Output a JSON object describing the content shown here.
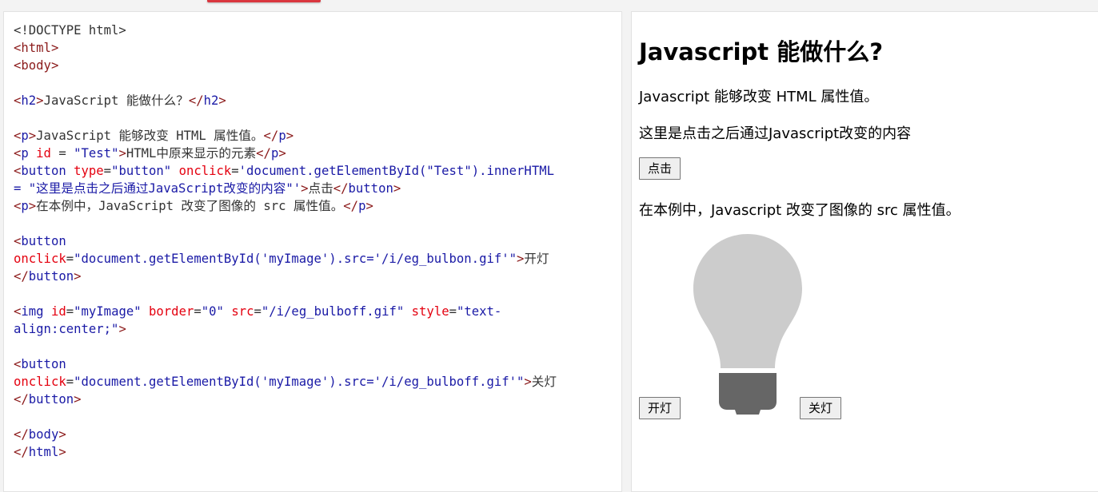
{
  "code_lines": [
    [
      {
        "t": "<!DOCTYPE html>",
        "c": "txt"
      }
    ],
    [
      {
        "t": "<",
        "c": "tag"
      },
      {
        "t": "html",
        "c": "tag"
      },
      {
        "t": ">",
        "c": "tag"
      }
    ],
    [
      {
        "t": "<",
        "c": "tag"
      },
      {
        "t": "body",
        "c": "tag"
      },
      {
        "t": ">",
        "c": "tag"
      }
    ],
    [],
    [
      {
        "t": "<",
        "c": "tag"
      },
      {
        "t": "h2",
        "c": "tn"
      },
      {
        "t": ">",
        "c": "tag"
      },
      {
        "t": "JavaScript 能做什么？",
        "c": "txt"
      },
      {
        "t": "</",
        "c": "tag"
      },
      {
        "t": "h2",
        "c": "tn"
      },
      {
        "t": ">",
        "c": "tag"
      }
    ],
    [],
    [
      {
        "t": "<",
        "c": "tag"
      },
      {
        "t": "p",
        "c": "tn"
      },
      {
        "t": ">",
        "c": "tag"
      },
      {
        "t": "JavaScript 能够改变 HTML 属性值。",
        "c": "txt"
      },
      {
        "t": "</",
        "c": "tag"
      },
      {
        "t": "p",
        "c": "tn"
      },
      {
        "t": ">",
        "c": "tag"
      }
    ],
    [
      {
        "t": "<",
        "c": "tag"
      },
      {
        "t": "p ",
        "c": "tn"
      },
      {
        "t": "id",
        "c": "attr"
      },
      {
        "t": " = ",
        "c": "txt"
      },
      {
        "t": "\"Test\"",
        "c": "val"
      },
      {
        "t": ">",
        "c": "tag"
      },
      {
        "t": "HTML中原来显示的元素",
        "c": "txt"
      },
      {
        "t": "</",
        "c": "tag"
      },
      {
        "t": "p",
        "c": "tn"
      },
      {
        "t": ">",
        "c": "tag"
      }
    ],
    [
      {
        "t": "<",
        "c": "tag"
      },
      {
        "t": "button ",
        "c": "tn"
      },
      {
        "t": "type",
        "c": "attr"
      },
      {
        "t": "=",
        "c": "txt"
      },
      {
        "t": "\"button\" ",
        "c": "val"
      },
      {
        "t": "onclick",
        "c": "attr"
      },
      {
        "t": "=",
        "c": "txt"
      },
      {
        "t": "'document.getElementById(\"Test\").innerHTML",
        "c": "val"
      }
    ],
    [
      {
        "t": "= \"这里是点击之后通过JavaScript改变的内容\"'",
        "c": "val"
      },
      {
        "t": ">",
        "c": "tag"
      },
      {
        "t": "点击",
        "c": "txt"
      },
      {
        "t": "</",
        "c": "tag"
      },
      {
        "t": "button",
        "c": "tn"
      },
      {
        "t": ">",
        "c": "tag"
      }
    ],
    [
      {
        "t": "<",
        "c": "tag"
      },
      {
        "t": "p",
        "c": "tn"
      },
      {
        "t": ">",
        "c": "tag"
      },
      {
        "t": "在本例中，JavaScript 改变了图像的 src 属性值。",
        "c": "txt"
      },
      {
        "t": "</",
        "c": "tag"
      },
      {
        "t": "p",
        "c": "tn"
      },
      {
        "t": ">",
        "c": "tag"
      }
    ],
    [],
    [
      {
        "t": "<",
        "c": "tag"
      },
      {
        "t": "button",
        "c": "tn"
      }
    ],
    [
      {
        "t": "onclick",
        "c": "attr"
      },
      {
        "t": "=",
        "c": "txt"
      },
      {
        "t": "\"document.getElementById('myImage').src='/i/eg_bulbon.gif'\"",
        "c": "val"
      },
      {
        "t": ">",
        "c": "tag"
      },
      {
        "t": "开灯",
        "c": "txt"
      }
    ],
    [
      {
        "t": "</",
        "c": "tag"
      },
      {
        "t": "button",
        "c": "tn"
      },
      {
        "t": ">",
        "c": "tag"
      }
    ],
    [],
    [
      {
        "t": "<",
        "c": "tag"
      },
      {
        "t": "img ",
        "c": "tn"
      },
      {
        "t": "id",
        "c": "attr"
      },
      {
        "t": "=",
        "c": "txt"
      },
      {
        "t": "\"myImage\" ",
        "c": "val"
      },
      {
        "t": "border",
        "c": "attr"
      },
      {
        "t": "=",
        "c": "txt"
      },
      {
        "t": "\"0\" ",
        "c": "val"
      },
      {
        "t": "src",
        "c": "attr"
      },
      {
        "t": "=",
        "c": "txt"
      },
      {
        "t": "\"/i/eg_bulboff.gif\" ",
        "c": "val"
      },
      {
        "t": "style",
        "c": "attr"
      },
      {
        "t": "=",
        "c": "txt"
      },
      {
        "t": "\"text-",
        "c": "val"
      }
    ],
    [
      {
        "t": "align:center;\"",
        "c": "val"
      },
      {
        "t": ">",
        "c": "tag"
      }
    ],
    [],
    [
      {
        "t": "<",
        "c": "tag"
      },
      {
        "t": "button",
        "c": "tn"
      }
    ],
    [
      {
        "t": "onclick",
        "c": "attr"
      },
      {
        "t": "=",
        "c": "txt"
      },
      {
        "t": "\"document.getElementById('myImage').src='/i/eg_bulboff.gif'\"",
        "c": "val"
      },
      {
        "t": ">",
        "c": "tag"
      },
      {
        "t": "关灯",
        "c": "txt"
      }
    ],
    [
      {
        "t": "</",
        "c": "tag"
      },
      {
        "t": "button",
        "c": "tn"
      },
      {
        "t": ">",
        "c": "tag"
      }
    ],
    [],
    [
      {
        "t": "</",
        "c": "tag"
      },
      {
        "t": "body",
        "c": "tn"
      },
      {
        "t": ">",
        "c": "tag"
      }
    ],
    [
      {
        "t": "</",
        "c": "tag"
      },
      {
        "t": "html",
        "c": "tn"
      },
      {
        "t": ">",
        "c": "tag"
      }
    ]
  ],
  "result": {
    "heading": "Javascript 能做什么?",
    "para1": "Javascript 能够改变 HTML 属性值。",
    "para2": "这里是点击之后通过Javascript改变的内容",
    "click_button": "点击",
    "para3": "在本例中，Javascript 改变了图像的 src 属性值。",
    "on_button": "开灯",
    "off_button": "关灯",
    "bulb_state": "off",
    "bulb_icon": "lightbulb-off-icon"
  },
  "colors": {
    "tag": "#8b1a1a",
    "tag_name": "#1a1aa6",
    "attr": "#e4000f",
    "value": "#1a1aa6",
    "bulb_glass": "#cccccc",
    "bulb_base": "#666666"
  }
}
